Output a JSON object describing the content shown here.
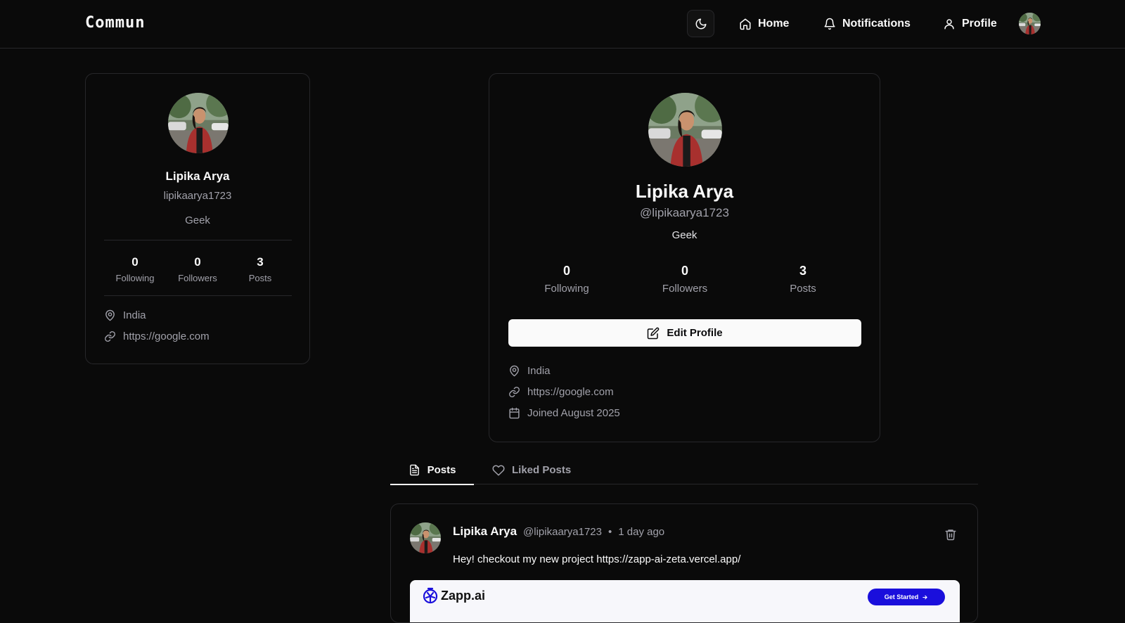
{
  "header": {
    "brand": "Commun",
    "nav": {
      "home": "Home",
      "notifications": "Notifications",
      "profile": "Profile"
    }
  },
  "sidebar_card": {
    "name": "Lipika Arya",
    "username": "lipikaarya1723",
    "bio": "Geek",
    "stats": [
      {
        "value": "0",
        "label": "Following"
      },
      {
        "value": "0",
        "label": "Followers"
      },
      {
        "value": "3",
        "label": "Posts"
      }
    ],
    "location": "India",
    "website": "https://google.com"
  },
  "profile": {
    "name": "Lipika Arya",
    "handle": "@lipikaarya1723",
    "bio": "Geek",
    "stats": [
      {
        "value": "0",
        "label": "Following"
      },
      {
        "value": "0",
        "label": "Followers"
      },
      {
        "value": "3",
        "label": "Posts"
      }
    ],
    "edit_button": "Edit Profile",
    "location": "India",
    "website": "https://google.com",
    "joined": "Joined August 2025"
  },
  "tabs": {
    "posts": "Posts",
    "liked": "Liked Posts"
  },
  "post": {
    "author": "Lipika Arya",
    "handle": "@lipikaarya1723",
    "separator": "•",
    "time": "1 day ago",
    "content": "Hey! checkout my new project https://zapp-ai-zeta.vercel.app/",
    "preview": {
      "logo_text": "Zapp.ai",
      "cta": "Get Started"
    }
  },
  "icons": {
    "theme": "moon-icon",
    "home": "home-icon",
    "notifications": "bell-icon",
    "profile": "user-icon",
    "location": "map-pin-icon",
    "website": "link-icon",
    "joined": "calendar-icon",
    "edit": "edit-icon",
    "posts_tab": "file-text-icon",
    "liked_tab": "heart-icon",
    "delete": "trash-icon"
  },
  "colors": {
    "background": "#0a0a0a",
    "border": "#27272a",
    "muted": "#a1a1aa",
    "preview_cta": "#1a0fdc"
  }
}
